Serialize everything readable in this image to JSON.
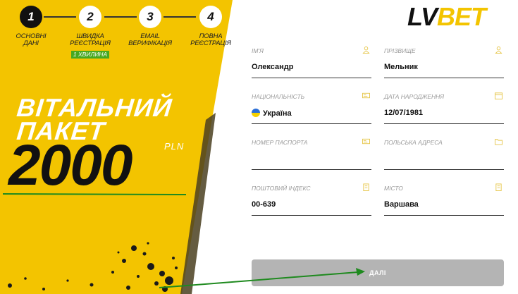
{
  "brand": {
    "logo_lv": "LV",
    "logo_bet": "BET"
  },
  "stepper": {
    "steps": [
      {
        "number": "1",
        "label_line1": "ОСНОВНІ",
        "label_line2": "ДАНІ",
        "badge": ""
      },
      {
        "number": "2",
        "label_line1": "ШВИДКА",
        "label_line2": "РЕЄСТРАЦІЯ",
        "badge": "1 ХВИЛИНА"
      },
      {
        "number": "3",
        "label_line1": "EMAIL",
        "label_line2": "ВЕРИФІКАЦІЯ",
        "badge": ""
      },
      {
        "number": "4",
        "label_line1": "ПОВНА",
        "label_line2": "РЕЄСТРАЦІЯ",
        "badge": ""
      }
    ],
    "active_step": 1
  },
  "promo": {
    "line1": "ВІТАЛЬНИЙ",
    "line2": "ПАКЕТ",
    "amount": "2000",
    "currency": "PLN"
  },
  "form": {
    "first_name": {
      "label": "ІМ'Я",
      "value": "Олександр",
      "icon": "user-icon"
    },
    "last_name": {
      "label": "ПРІЗВИЩЕ",
      "value": "Мельник",
      "icon": "user-icon"
    },
    "nationality": {
      "label": "НАЦІОНАЛЬНІСТЬ",
      "value": "Україна",
      "icon": "id-card-icon"
    },
    "birth_date": {
      "label": "ДАТА НАРОДЖЕННЯ",
      "value": "12/07/1981",
      "icon": "calendar-icon"
    },
    "passport": {
      "label": "НОМЕР ПАСПОРТА",
      "value": "",
      "icon": "id-card-icon"
    },
    "address": {
      "label": "ПОЛЬСЬКА АДРЕСА",
      "value": "",
      "icon": "folder-icon"
    },
    "postal_code": {
      "label": "ПОШТОВИЙ ІНДЕКС",
      "value": "00-639",
      "icon": "building-icon"
    },
    "city": {
      "label": "МІСТО",
      "value": "Варшава",
      "icon": "building-icon"
    },
    "next_label": "ДАЛІ"
  },
  "colors": {
    "brand_yellow": "#f3c400",
    "dark": "#111111",
    "button_disabled": "#b4b4b4",
    "annotation_green": "#1f8a1f",
    "badge_green": "#46a820"
  }
}
